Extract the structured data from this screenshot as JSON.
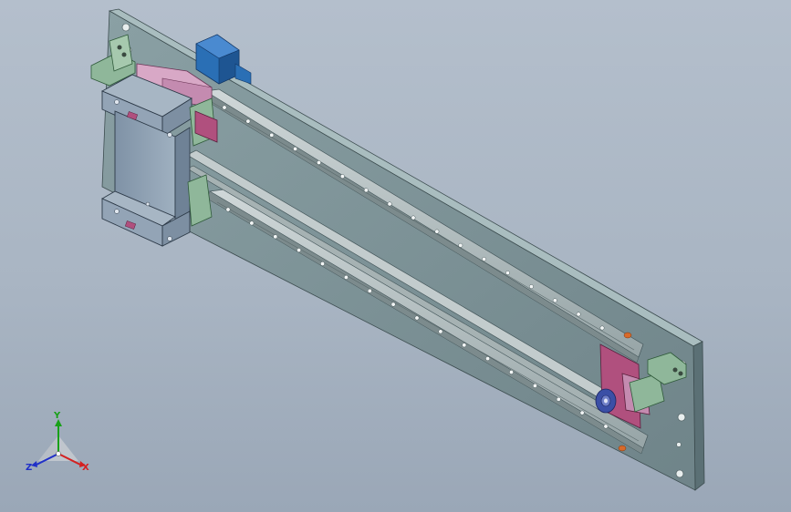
{
  "viewport": {
    "background_top": "#b4bfcc",
    "background_bottom": "#9aa7b7"
  },
  "colors": {
    "plate_face": "#7e9398",
    "plate_top": "#a7bcbe",
    "plate_side": "#5f7479",
    "rail": "#b9c3c4",
    "rail_dark": "#8c9a9c",
    "carriage": "#8d9eb0",
    "carriage_light": "#a7b6c4",
    "bracket_green": "#8fb79a",
    "mount_magenta": "#b0507e",
    "pink_block": "#d8a8c6",
    "motor_blue": "#2a6fb5",
    "accent_orange": "#d86a2a",
    "pulley_blue": "#3b4fa6",
    "axis_x": "#d42020",
    "axis_y": "#18a018",
    "axis_z": "#2030c8"
  },
  "icons": [
    "motor-icon",
    "pulley-icon"
  ],
  "triad": {
    "x_label": "X",
    "y_label": "Y",
    "z_label": "Z"
  }
}
